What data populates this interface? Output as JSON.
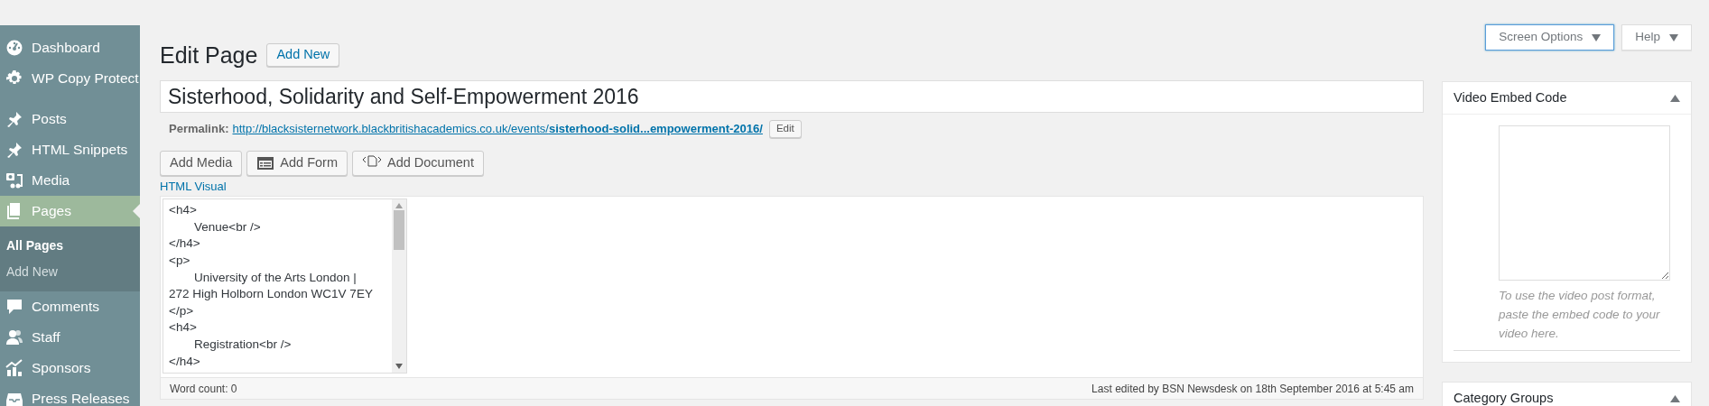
{
  "sidebar": {
    "items": [
      {
        "label": "Dashboard",
        "selected": false
      },
      {
        "label": "WP Copy Protect",
        "selected": false
      },
      {
        "label": "Posts",
        "selected": false
      },
      {
        "label": "HTML Snippets",
        "selected": false
      },
      {
        "label": "Media",
        "selected": false
      },
      {
        "label": "Pages",
        "selected": true,
        "children": [
          {
            "label": "All Pages",
            "selected": true
          },
          {
            "label": "Add New",
            "selected": false
          }
        ]
      },
      {
        "label": "Comments",
        "selected": false
      },
      {
        "label": "Staff",
        "selected": false
      },
      {
        "label": "Sponsors",
        "selected": false
      },
      {
        "label": "Press Releases",
        "selected": false
      }
    ]
  },
  "header": {
    "title": "Edit Page",
    "add_new": "Add New"
  },
  "top_buttons": [
    {
      "label": "Screen Options",
      "focused": true
    },
    {
      "label": "Help",
      "focused": false
    }
  ],
  "post_title": {
    "value": "Sisterhood, Solidarity and Self-Empowerment 2016"
  },
  "permalink": {
    "label": "Permalink:",
    "url_base": "http://blacksisternetwork.blackbritishacademics.co.uk/events/",
    "url_slug": "sisterhood-solid...empowerment-2016/",
    "edit": "Edit"
  },
  "media_buttons": [
    {
      "label": "Add Media"
    },
    {
      "label": "Add Form"
    },
    {
      "label": "Add Document"
    }
  ],
  "editor_tabs": "HTML Visual",
  "editor_lines": [
    {
      "text": "<h4>",
      "indented": false
    },
    {
      "text": "Venue<br />",
      "indented": true
    },
    {
      "text": "</h4>",
      "indented": false
    },
    {
      "text": "<p>",
      "indented": false
    },
    {
      "text": "University of the Arts London | 272 High Holborn London WC1V 7EY",
      "indented": true
    },
    {
      "text": "</p>",
      "indented": false
    },
    {
      "text": "<h4>",
      "indented": false
    },
    {
      "text": "Registration<br />",
      "indented": true
    },
    {
      "text": "</h4>",
      "indented": false
    }
  ],
  "status_bar": {
    "word_count": "Word count: 0",
    "last_edited": "Last edited by BSN Newsdesk on 18th September 2016 at 5:45 am"
  },
  "panels": [
    {
      "title": "Video Embed Code",
      "expanded": true,
      "help": "To use the video post format, paste the embed code to your video here."
    },
    {
      "title": "Category Groups",
      "expanded": true
    }
  ]
}
